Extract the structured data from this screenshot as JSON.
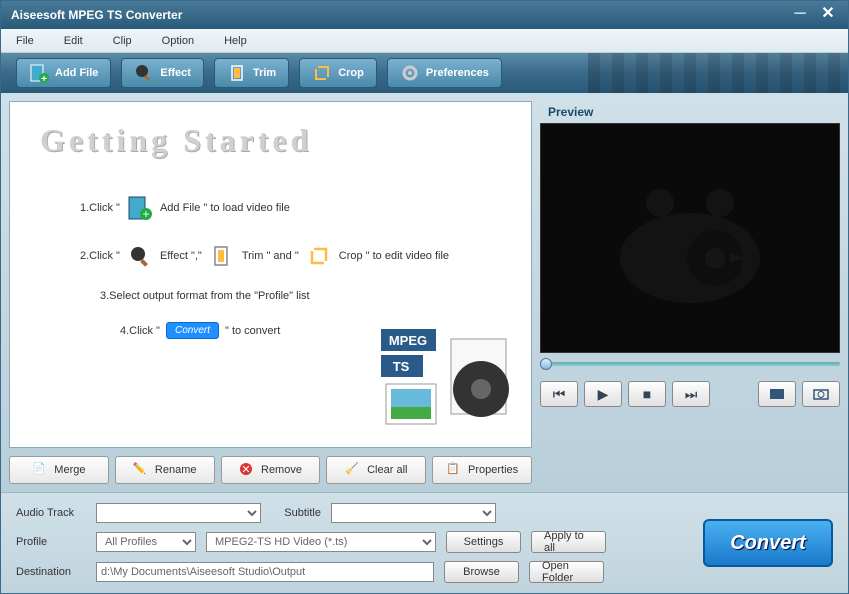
{
  "title": "Aiseesoft MPEG TS Converter",
  "menu": {
    "file": "File",
    "edit": "Edit",
    "clip": "Clip",
    "option": "Option",
    "help": "Help"
  },
  "toolbar": {
    "addfile": "Add File",
    "effect": "Effect",
    "trim": "Trim",
    "crop": "Crop",
    "preferences": "Preferences"
  },
  "content": {
    "heading": "Getting  Started",
    "step1a": "1.Click \"",
    "step1b": "Add File \" to load video file",
    "step2a": "2.Click \"",
    "step2b": "Effect \",\"",
    "step2c": "Trim \" and \"",
    "step2d": "Crop \" to edit video file",
    "step3": "3.Select output format from the \"Profile\" list",
    "step4a": "4.Click \"",
    "step4b": "Convert",
    "step4c": "\" to convert"
  },
  "actions": {
    "merge": "Merge",
    "rename": "Rename",
    "remove": "Remove",
    "clearall": "Clear all",
    "properties": "Properties"
  },
  "preview": {
    "label": "Preview"
  },
  "form": {
    "audiotrack_label": "Audio Track",
    "audiotrack_value": "",
    "subtitle_label": "Subtitle",
    "subtitle_value": "",
    "profile_label": "Profile",
    "profile_group": "All Profiles",
    "profile_value": "MPEG2-TS HD Video (*.ts)",
    "destination_label": "Destination",
    "destination_value": "d:\\My Documents\\Aiseesoft Studio\\Output",
    "settings": "Settings",
    "applyall": "Apply to all",
    "browse": "Browse",
    "openfolder": "Open Folder",
    "convert": "Convert"
  }
}
